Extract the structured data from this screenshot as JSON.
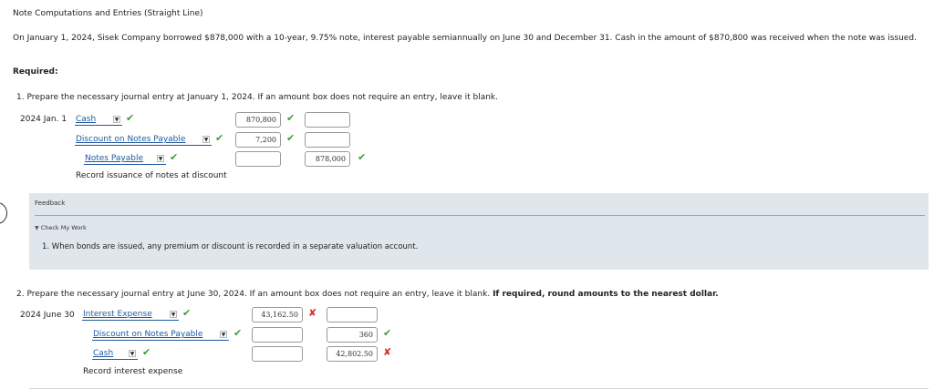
{
  "page": {
    "title": "Note Computations and Entries (Straight Line)",
    "intro": "On January 1, 2024, Sisek Company borrowed $878,000 with a 10-year, 9.75% note, interest payable semiannually on June 30 and December 31. Cash in the amount of $870,800 was received when the note was issued.",
    "required": "Required:"
  },
  "q1": {
    "prompt": "1.  Prepare the necessary journal entry at January 1, 2024. If an amount box does not require an entry, leave it blank.",
    "date": "2024 Jan. 1",
    "rows": [
      {
        "account": "Cash",
        "debit": "870,800",
        "credit": "",
        "account_status": "correct",
        "debit_status": "correct"
      },
      {
        "account": "Discount on Notes Payable",
        "debit": "7,200",
        "credit": "",
        "account_status": "correct",
        "debit_status": "correct"
      },
      {
        "account": "Notes Payable",
        "debit": "",
        "credit": "878,000",
        "account_status": "correct",
        "credit_status": "correct"
      }
    ],
    "description": "Record issuance of notes at discount"
  },
  "feedback": {
    "label": "Feedback",
    "check_my_work": "Check My Work",
    "message": "1. When bonds are issued, any premium or discount is recorded in a separate valuation account."
  },
  "q2": {
    "prompt_plain": "2.  Prepare the necessary journal entry at June 30, 2024. If an amount box does not require an entry, leave it blank.",
    "prompt_bold": "If required, round amounts to the nearest dollar.",
    "date": "2024 June 30",
    "rows": [
      {
        "account": "Interest Expense",
        "debit": "43,162.50",
        "credit": "",
        "account_status": "correct",
        "debit_status": "incorrect"
      },
      {
        "account": "Discount on Notes Payable",
        "debit": "",
        "credit": "360",
        "account_status": "correct",
        "credit_status": "correct"
      },
      {
        "account": "Cash",
        "debit": "",
        "credit": "42,802.50",
        "account_status": "correct",
        "credit_status": "incorrect"
      }
    ],
    "description": "Record interest expense"
  },
  "marks": {
    "correct": "✔",
    "incorrect": "✘",
    "caret": "▼",
    "collapse": "▼"
  }
}
